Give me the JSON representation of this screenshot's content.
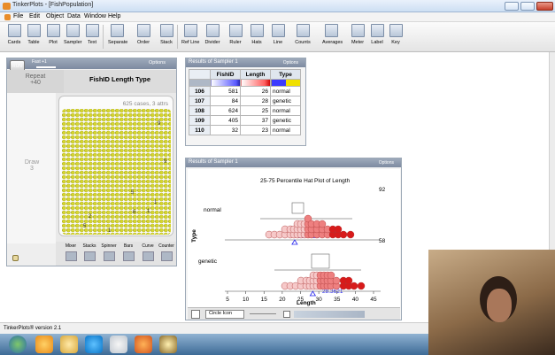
{
  "window": {
    "title": "TinkerPlots - [FishPopulation]"
  },
  "menu": [
    "File",
    "Edit",
    "Object",
    "Data",
    "Window",
    "Help"
  ],
  "toolbar": [
    "Cards",
    "Table",
    "Plot",
    "Sampler",
    "Text",
    "Separate",
    "Order",
    "Stack",
    "Ref Line",
    "Divider",
    "Ruler",
    "Hats",
    "Line",
    "Counts",
    "Averages",
    "Meter",
    "Label",
    "Key"
  ],
  "sampler": {
    "run": "RUN",
    "speed": "Fast +1",
    "options": "Options",
    "repeat_label": "Repeat",
    "repeat_value": "+40",
    "column_header": "FishID Length Type",
    "cases_text": "625 cases, 3 attrs",
    "draw_label": "Draw",
    "draw_value": "3",
    "visible_numbers": [
      "9",
      "9",
      "5",
      "1",
      "1",
      "6",
      "2",
      "5",
      "1"
    ],
    "devices": [
      "Mixer",
      "Stacks",
      "Spinner",
      "Bars",
      "Curve",
      "Counter"
    ]
  },
  "table": {
    "title": "Results of Sampler 1",
    "options": "Options",
    "headers": [
      "FishID",
      "Length",
      "Type"
    ],
    "rows": [
      [
        "106",
        "581",
        "26",
        "normal"
      ],
      [
        "107",
        "84",
        "28",
        "genetic"
      ],
      [
        "108",
        "624",
        "25",
        "normal"
      ],
      [
        "109",
        "405",
        "37",
        "genetic"
      ],
      [
        "110",
        "32",
        "23",
        "normal"
      ]
    ]
  },
  "plot": {
    "window_title": "Results of Sampler 1",
    "options": "Options",
    "title": "25-75 Percentile Hat Plot of Length",
    "normal_label": "normal",
    "genetic_label": "genetic",
    "type_axis": "Type",
    "normal_count": "92",
    "genetic_count": "58",
    "normal_mean": "23.4022",
    "genetic_mean": "28.3621",
    "xlabel": "Length",
    "circle_icon": "Circle Icon"
  },
  "status": {
    "version": "TinkerPlots® version 2.1"
  },
  "chart_data": {
    "type": "scatter",
    "title": "25-75 Percentile Hat Plot of Length",
    "xlabel": "Length",
    "ylabel": "Type",
    "xlim": [
      5,
      45
    ],
    "xticks": [
      "5",
      "10",
      "15",
      "20",
      "25",
      "30",
      "35",
      "40",
      "45"
    ],
    "series": [
      {
        "name": "normal",
        "count": 92,
        "mean": 23.4022
      },
      {
        "name": "genetic",
        "count": 58,
        "mean": 28.3621
      }
    ]
  },
  "colors": {
    "accent": "#7d8aa0",
    "balls": "#cccc22",
    "dots_light": "#f4c2c2",
    "dots_dark": "#dd1111",
    "mean": "#2222ee"
  }
}
